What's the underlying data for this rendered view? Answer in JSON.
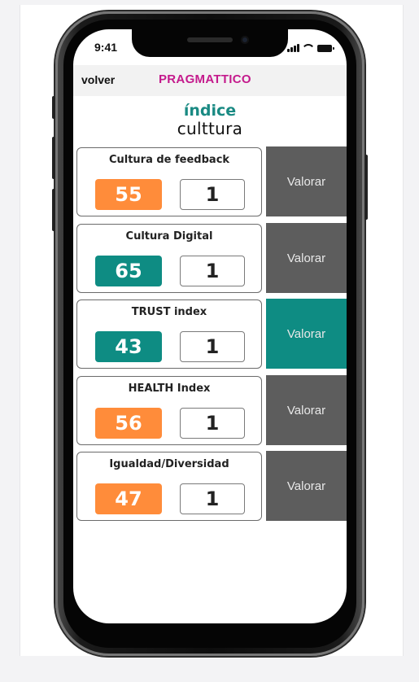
{
  "status": {
    "time": "9:41"
  },
  "appbar": {
    "back_label": "volver",
    "brand": "PRAGMATTICO"
  },
  "logo": {
    "line1": "índice",
    "line2": "culttura"
  },
  "colors": {
    "orange": "#ff8c3a",
    "teal": "#0e8c83",
    "gray_button": "#5d5d5d",
    "teal_button": "#0e8c83",
    "brand": "#c41a8c"
  },
  "items": [
    {
      "title": "Cultura de feedback",
      "score": "55",
      "count": "1",
      "score_color": "orange",
      "action_label": "Valorar",
      "action_color": "gray"
    },
    {
      "title": "Cultura Digital",
      "score": "65",
      "count": "1",
      "score_color": "teal",
      "action_label": "Valorar",
      "action_color": "gray"
    },
    {
      "title": "TRUST index",
      "score": "43",
      "count": "1",
      "score_color": "teal",
      "action_label": "Valorar",
      "action_color": "teal"
    },
    {
      "title": "HEALTH Index",
      "score": "56",
      "count": "1",
      "score_color": "orange",
      "action_label": "Valorar",
      "action_color": "gray"
    },
    {
      "title": "Igualdad/Diversidad",
      "score": "47",
      "count": "1",
      "score_color": "orange",
      "action_label": "Valorar",
      "action_color": "gray"
    }
  ]
}
